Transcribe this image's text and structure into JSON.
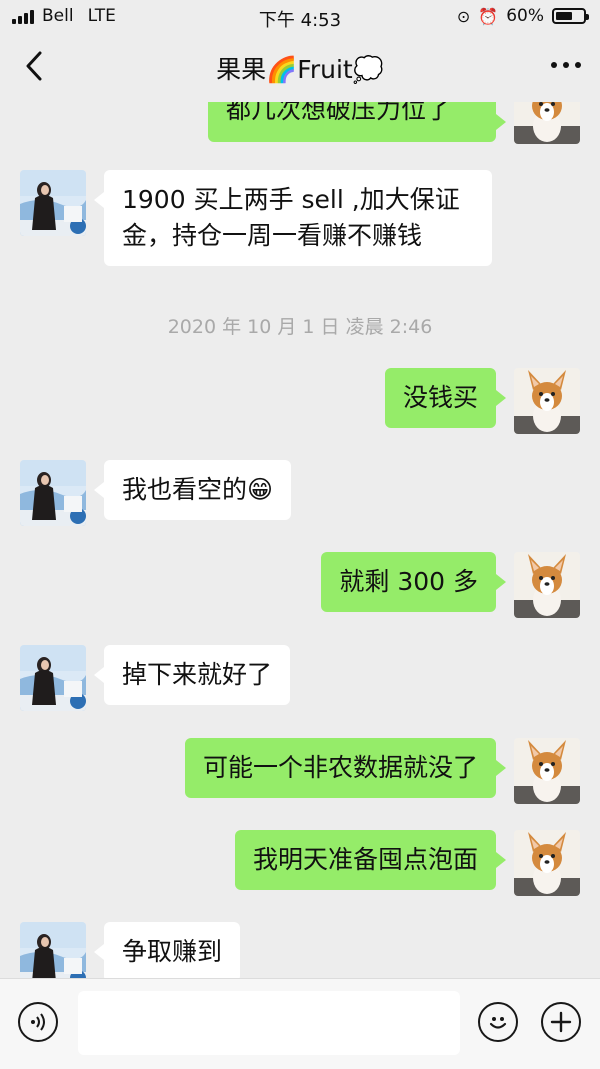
{
  "status_bar": {
    "carrier": "Bell",
    "network": "LTE",
    "time": "下午 4:53",
    "battery": "60%",
    "battery_level": 0.6
  },
  "header": {
    "title": "果果🌈Fruit💭",
    "back_icon": "chevron-left-icon",
    "more_icon": "more-dots-icon"
  },
  "messages": [
    {
      "side": "out",
      "text": "都几次想破压力位了",
      "partial": true
    },
    {
      "side": "in",
      "text": "1900 买上两手 sell ,加大保证金，持仓一周一看赚不赚钱"
    },
    {
      "side": "out",
      "text": "没钱买"
    },
    {
      "side": "in",
      "text": "我也看空的😁"
    },
    {
      "side": "out",
      "text": "就剩 300 多"
    },
    {
      "side": "in",
      "text": "掉下来就好了"
    },
    {
      "side": "out",
      "text": "可能一个非农数据就没了"
    },
    {
      "side": "out",
      "text": "我明天准备囤点泡面"
    },
    {
      "side": "in",
      "text": "争取赚到",
      "partial": true
    }
  ],
  "timestamp": "2020 年 10 月 1 日 凌晨 2:46",
  "input_bar": {
    "voice_icon": "voice-icon",
    "emoji_icon": "emoji-icon",
    "add_icon": "plus-icon",
    "input_value": ""
  },
  "colors": {
    "background": "#ededed",
    "outgoing_bubble": "#95ec69",
    "incoming_bubble": "#ffffff"
  }
}
